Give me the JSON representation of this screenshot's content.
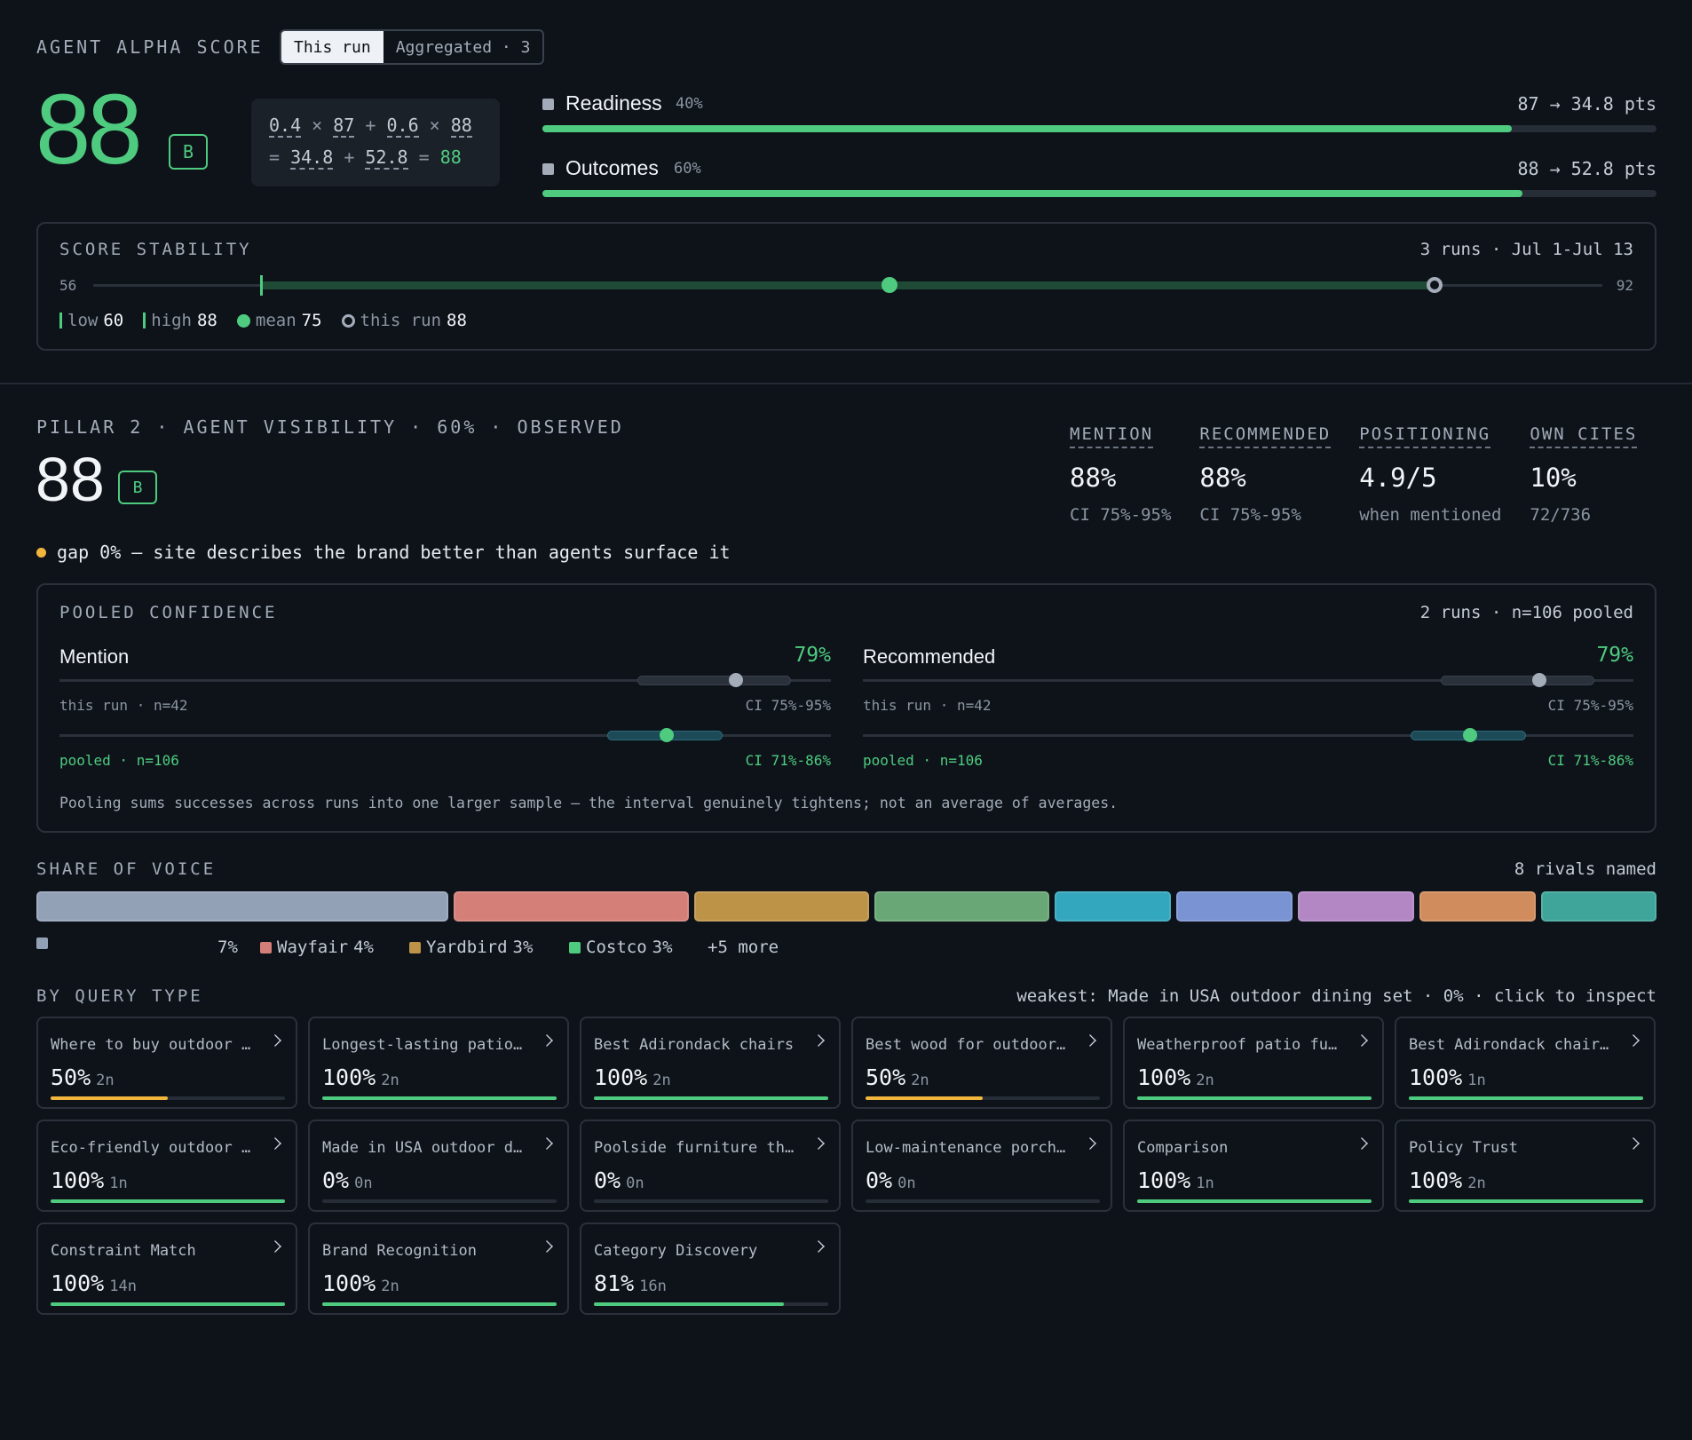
{
  "header": {
    "title": "AGENT ALPHA SCORE",
    "tabs": [
      {
        "label": "This run",
        "active": true
      },
      {
        "label": "Aggregated · 3",
        "active": false
      }
    ],
    "score": "88",
    "grade": "B",
    "formula": {
      "w1": "0.4",
      "x": "×",
      "v1": "87",
      "plus": "+",
      "w2": "0.6",
      "v2": "88",
      "eq": "=",
      "p1": "34.8",
      "p2": "52.8",
      "total": "88"
    },
    "components": [
      {
        "name": "Readiness",
        "weight": "40%",
        "summary": "87 → 34.8 pts",
        "value": 87
      },
      {
        "name": "Outcomes",
        "weight": "60%",
        "summary": "88 → 52.8 pts",
        "value": 88
      }
    ]
  },
  "stability": {
    "title": "SCORE STABILITY",
    "meta": "3 runs · Jul 1-Jul 13",
    "min_label": "56",
    "max_label": "92",
    "min": 56,
    "max": 92,
    "low": 60,
    "high": 88,
    "mean": 75,
    "this_run": 88,
    "legend": {
      "low_label": "low",
      "low_value": "60",
      "high_label": "high",
      "high_value": "88",
      "mean_label": "mean",
      "mean_value": "75",
      "run_label": "this run",
      "run_value": "88"
    }
  },
  "pillar": {
    "title": "PILLAR 2 · AGENT VISIBILITY · 60% · OBSERVED",
    "score": "88",
    "grade": "B",
    "gap_text": "gap 0% — site describes the brand better than agents surface it",
    "metrics": [
      {
        "label": "MENTION",
        "value": "88%",
        "sub": "CI 75%-95%"
      },
      {
        "label": "RECOMMENDED",
        "value": "88%",
        "sub": "CI 75%-95%"
      },
      {
        "label": "POSITIONING",
        "value": "4.9/5",
        "sub": "when mentioned"
      },
      {
        "label": "OWN CITES",
        "value": "10%",
        "sub": "72/736"
      }
    ]
  },
  "pooled": {
    "title": "POOLED CONFIDENCE",
    "meta": "2 runs · n=106 pooled",
    "cols": [
      {
        "name": "Mention",
        "value": "79%",
        "run_label": "this run · n=42",
        "run_ci": "CI 75%-95%",
        "pool_label": "pooled · n=106",
        "pool_ci": "CI 71%-86%"
      },
      {
        "name": "Recommended",
        "value": "79%",
        "run_label": "this run · n=42",
        "run_ci": "CI 75%-95%",
        "pool_label": "pooled · n=106",
        "pool_ci": "CI 71%-86%"
      }
    ],
    "note": "Pooling sums successes across runs into one larger sample — the interval genuinely tightens; not an average of averages."
  },
  "sov": {
    "title": "SHARE OF VOICE",
    "meta": "8 rivals named",
    "colors": [
      "#93a1b7",
      "#d47f78",
      "#bd9348",
      "#6aa776",
      "#33a7bd",
      "#7993d3",
      "#b287c4",
      "#d18c5d",
      "#3fa59a"
    ],
    "legend": [
      {
        "label": "",
        "value": "7%",
        "color": "#93a1b7"
      },
      {
        "label": "Wayfair",
        "value": "4%",
        "color": "#d47f78"
      },
      {
        "label": "Yardbird",
        "value": "3%",
        "color": "#bd9348"
      },
      {
        "label": "Costco",
        "value": "3%",
        "color": "#4ecb7f"
      }
    ],
    "more": "+5 more"
  },
  "queries": {
    "title": "BY QUERY TYPE",
    "meta": "weakest: Made in USA outdoor dining set · 0% · click to inspect",
    "items": [
      {
        "name": "Where to buy outdoor patio furniture",
        "pct": "50%",
        "n": "2n",
        "value": 50
      },
      {
        "name": "Longest-lasting patio furniture",
        "pct": "100%",
        "n": "2n",
        "value": 100
      },
      {
        "name": "Best Adirondack chairs",
        "pct": "100%",
        "n": "2n",
        "value": 100
      },
      {
        "name": "Best wood for outdoor furniture",
        "pct": "50%",
        "n": "2n",
        "value": 50
      },
      {
        "name": "Weatherproof patio furniture",
        "pct": "100%",
        "n": "2n",
        "value": 100
      },
      {
        "name": "Best Adirondack chairs for",
        "pct": "100%",
        "n": "1n",
        "value": 100
      },
      {
        "name": "Eco-friendly outdoor furniture",
        "pct": "100%",
        "n": "1n",
        "value": 100
      },
      {
        "name": "Made in USA outdoor dining set",
        "pct": "0%",
        "n": "0n",
        "value": 0
      },
      {
        "name": "Poolside furniture that",
        "pct": "0%",
        "n": "0n",
        "value": 0
      },
      {
        "name": "Low-maintenance porch furniture",
        "pct": "0%",
        "n": "0n",
        "value": 0
      },
      {
        "name": "Comparison",
        "pct": "100%",
        "n": "1n",
        "value": 100
      },
      {
        "name": "Policy Trust",
        "pct": "100%",
        "n": "2n",
        "value": 100
      },
      {
        "name": "Constraint Match",
        "pct": "100%",
        "n": "14n",
        "value": 100
      },
      {
        "name": "Brand Recognition",
        "pct": "100%",
        "n": "2n",
        "value": 100
      },
      {
        "name": "Category Discovery",
        "pct": "81%",
        "n": "16n",
        "value": 81
      }
    ]
  }
}
